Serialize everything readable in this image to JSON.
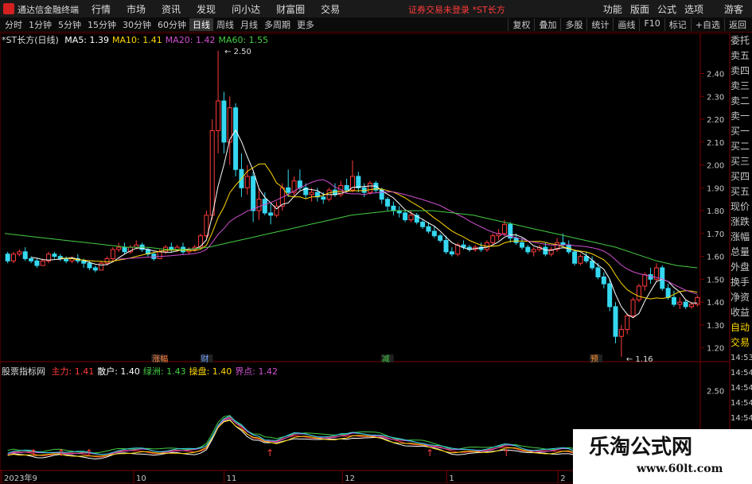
{
  "app": {
    "title": "通达信金融终端"
  },
  "menu": [
    "行情",
    "市场",
    "资讯",
    "发现",
    "问小达",
    "财富圈",
    "交易"
  ],
  "status_notice": "证券交易未登录  *ST长方",
  "right_menu": [
    "功能",
    "版面",
    "公式",
    "选项"
  ],
  "guest_label": "游客",
  "periods": [
    "分时",
    "1分钟",
    "5分钟",
    "15分钟",
    "30分钟",
    "60分钟",
    "日线",
    "周线",
    "月线",
    "多周期",
    "更多"
  ],
  "active_period": "日线",
  "tools": [
    "复权",
    "叠加",
    "多股",
    "统计",
    "画线",
    "F10",
    "标记",
    "+自选",
    "返回"
  ],
  "stock_label": "*ST长方(日线)",
  "ma": [
    {
      "label": "MA5: 1.39",
      "color": "#ffffff"
    },
    {
      "label": "MA10: 1.41",
      "color": "#ffd700"
    },
    {
      "label": "MA20: 1.42",
      "color": "#d04fd0"
    },
    {
      "label": "MA60: 1.55",
      "color": "#44cc44"
    }
  ],
  "sidebar": [
    "委托",
    "卖五",
    "卖四",
    "卖三",
    "卖二",
    "卖一",
    "买一",
    "买二",
    "买三",
    "买四",
    "买五",
    "现价",
    "涨跌",
    "涨幅",
    "总量",
    "外盘",
    "换手",
    "净资",
    "收益",
    "自动",
    "交易",
    "14:53",
    "14:54",
    "14:54",
    "14:54",
    "14:54",
    "14:54",
    "14:54",
    "14:54"
  ],
  "sidebar_colors": {
    "auto": "#ffd700",
    "trade": "#ffd700"
  },
  "indicator": {
    "name": "股票指标网",
    "items": [
      {
        "label": "主力: 1.41",
        "color": "#ff3b3b"
      },
      {
        "label": "散户: 1.40",
        "color": "#ffffff"
      },
      {
        "label": "绿洲: 1.43",
        "color": "#44cc44"
      },
      {
        "label": "操盘: 1.40",
        "color": "#ffd700"
      },
      {
        "label": "界点: 1.42",
        "color": "#d04fd0"
      }
    ]
  },
  "markers": [
    {
      "text": "涨幅",
      "color": "#ff8040"
    },
    {
      "text": "财",
      "color": "#6fa0ff"
    },
    {
      "text": "减",
      "color": "#44cc44"
    },
    {
      "text": "预",
      "color": "#ff9030"
    }
  ],
  "annotations": {
    "high": "2.50",
    "low": "1.16"
  },
  "x_dates": [
    "2023年9",
    "10",
    "11",
    "12",
    "1",
    "2"
  ],
  "colors": {
    "up": "#ff3b3b",
    "down": "#35d8f0",
    "axis": "#7a0000",
    "grid": "#400000"
  },
  "chart_data": {
    "type": "candlestick",
    "title": "*ST长方(日线)",
    "y_ticks": [
      1.2,
      1.3,
      1.4,
      1.5,
      1.6,
      1.7,
      1.8,
      1.9,
      2.0,
      2.1,
      2.2,
      2.3,
      2.4
    ],
    "ylim": [
      1.15,
      2.52
    ],
    "ind_ticks": [
      2.0,
      2.5
    ],
    "ind_ylim": [
      1.75,
      2.65
    ],
    "ohlc": [
      [
        1.61,
        1.62,
        1.57,
        1.58
      ],
      [
        1.58,
        1.62,
        1.57,
        1.61
      ],
      [
        1.61,
        1.63,
        1.6,
        1.62
      ],
      [
        1.62,
        1.64,
        1.58,
        1.59
      ],
      [
        1.59,
        1.6,
        1.57,
        1.58
      ],
      [
        1.58,
        1.59,
        1.55,
        1.56
      ],
      [
        1.56,
        1.59,
        1.56,
        1.58
      ],
      [
        1.58,
        1.62,
        1.57,
        1.61
      ],
      [
        1.61,
        1.62,
        1.59,
        1.6
      ],
      [
        1.6,
        1.61,
        1.58,
        1.59
      ],
      [
        1.59,
        1.6,
        1.57,
        1.58
      ],
      [
        1.58,
        1.6,
        1.57,
        1.59
      ],
      [
        1.59,
        1.61,
        1.57,
        1.58
      ],
      [
        1.58,
        1.59,
        1.55,
        1.57
      ],
      [
        1.57,
        1.58,
        1.54,
        1.55
      ],
      [
        1.55,
        1.56,
        1.53,
        1.54
      ],
      [
        1.54,
        1.58,
        1.54,
        1.57
      ],
      [
        1.57,
        1.6,
        1.56,
        1.59
      ],
      [
        1.59,
        1.64,
        1.58,
        1.63
      ],
      [
        1.63,
        1.66,
        1.62,
        1.64
      ],
      [
        1.64,
        1.66,
        1.61,
        1.62
      ],
      [
        1.62,
        1.65,
        1.61,
        1.64
      ],
      [
        1.64,
        1.67,
        1.63,
        1.65
      ],
      [
        1.65,
        1.66,
        1.62,
        1.63
      ],
      [
        1.63,
        1.64,
        1.6,
        1.61
      ],
      [
        1.61,
        1.62,
        1.58,
        1.59
      ],
      [
        1.59,
        1.63,
        1.59,
        1.62
      ],
      [
        1.62,
        1.65,
        1.61,
        1.64
      ],
      [
        1.64,
        1.66,
        1.62,
        1.63
      ],
      [
        1.63,
        1.65,
        1.62,
        1.64
      ],
      [
        1.64,
        1.66,
        1.61,
        1.62
      ],
      [
        1.62,
        1.64,
        1.61,
        1.63
      ],
      [
        1.63,
        1.65,
        1.62,
        1.64
      ],
      [
        1.64,
        1.7,
        1.63,
        1.69
      ],
      [
        1.69,
        1.8,
        1.68,
        1.78
      ],
      [
        1.78,
        2.2,
        1.76,
        2.15
      ],
      [
        2.15,
        2.5,
        2.05,
        2.28
      ],
      [
        2.28,
        2.32,
        2.05,
        2.1
      ],
      [
        2.1,
        2.3,
        2.0,
        2.25
      ],
      [
        2.25,
        2.27,
        1.95,
        1.98
      ],
      [
        1.98,
        2.05,
        1.86,
        1.9
      ],
      [
        1.9,
        2.0,
        1.87,
        1.95
      ],
      [
        1.95,
        1.97,
        1.75,
        1.8
      ],
      [
        1.8,
        1.9,
        1.76,
        1.85
      ],
      [
        1.85,
        1.88,
        1.78,
        1.79
      ],
      [
        1.79,
        1.83,
        1.74,
        1.78
      ],
      [
        1.78,
        1.84,
        1.77,
        1.82
      ],
      [
        1.82,
        1.92,
        1.8,
        1.9
      ],
      [
        1.9,
        1.98,
        1.86,
        1.88
      ],
      [
        1.88,
        1.95,
        1.86,
        1.93
      ],
      [
        1.93,
        1.98,
        1.89,
        1.9
      ],
      [
        1.9,
        1.92,
        1.85,
        1.87
      ],
      [
        1.87,
        1.9,
        1.84,
        1.88
      ],
      [
        1.88,
        1.9,
        1.84,
        1.86
      ],
      [
        1.86,
        1.88,
        1.83,
        1.85
      ],
      [
        1.85,
        1.9,
        1.84,
        1.89
      ],
      [
        1.89,
        1.92,
        1.86,
        1.87
      ],
      [
        1.87,
        1.93,
        1.86,
        1.91
      ],
      [
        1.91,
        1.94,
        1.88,
        1.89
      ],
      [
        1.89,
        2.02,
        1.88,
        1.95
      ],
      [
        1.95,
        1.97,
        1.88,
        1.9
      ],
      [
        1.9,
        1.92,
        1.86,
        1.88
      ],
      [
        1.88,
        1.93,
        1.87,
        1.92
      ],
      [
        1.92,
        1.93,
        1.88,
        1.89
      ],
      [
        1.89,
        1.9,
        1.83,
        1.85
      ],
      [
        1.85,
        1.86,
        1.8,
        1.82
      ],
      [
        1.82,
        1.84,
        1.78,
        1.8
      ],
      [
        1.8,
        1.82,
        1.77,
        1.79
      ],
      [
        1.79,
        1.8,
        1.75,
        1.76
      ],
      [
        1.76,
        1.8,
        1.75,
        1.78
      ],
      [
        1.78,
        1.79,
        1.74,
        1.75
      ],
      [
        1.75,
        1.76,
        1.72,
        1.73
      ],
      [
        1.73,
        1.75,
        1.7,
        1.71
      ],
      [
        1.71,
        1.73,
        1.68,
        1.69
      ],
      [
        1.69,
        1.7,
        1.66,
        1.67
      ],
      [
        1.67,
        1.69,
        1.61,
        1.62
      ],
      [
        1.62,
        1.64,
        1.6,
        1.61
      ],
      [
        1.61,
        1.66,
        1.6,
        1.65
      ],
      [
        1.65,
        1.67,
        1.63,
        1.64
      ],
      [
        1.64,
        1.65,
        1.62,
        1.63
      ],
      [
        1.63,
        1.65,
        1.62,
        1.64
      ],
      [
        1.64,
        1.66,
        1.62,
        1.63
      ],
      [
        1.63,
        1.67,
        1.62,
        1.66
      ],
      [
        1.66,
        1.7,
        1.65,
        1.69
      ],
      [
        1.69,
        1.72,
        1.67,
        1.7
      ],
      [
        1.7,
        1.76,
        1.69,
        1.74
      ],
      [
        1.74,
        1.75,
        1.66,
        1.68
      ],
      [
        1.68,
        1.7,
        1.65,
        1.66
      ],
      [
        1.66,
        1.68,
        1.63,
        1.64
      ],
      [
        1.64,
        1.65,
        1.61,
        1.62
      ],
      [
        1.62,
        1.64,
        1.6,
        1.63
      ],
      [
        1.63,
        1.65,
        1.62,
        1.64
      ],
      [
        1.64,
        1.66,
        1.6,
        1.61
      ],
      [
        1.61,
        1.64,
        1.6,
        1.63
      ],
      [
        1.63,
        1.68,
        1.62,
        1.66
      ],
      [
        1.66,
        1.7,
        1.64,
        1.65
      ],
      [
        1.65,
        1.67,
        1.61,
        1.62
      ],
      [
        1.62,
        1.63,
        1.56,
        1.57
      ],
      [
        1.57,
        1.61,
        1.56,
        1.6
      ],
      [
        1.6,
        1.62,
        1.57,
        1.58
      ],
      [
        1.58,
        1.6,
        1.54,
        1.55
      ],
      [
        1.55,
        1.57,
        1.5,
        1.51
      ],
      [
        1.51,
        1.53,
        1.46,
        1.48
      ],
      [
        1.48,
        1.5,
        1.36,
        1.38
      ],
      [
        1.38,
        1.4,
        1.22,
        1.25
      ],
      [
        1.25,
        1.3,
        1.16,
        1.28
      ],
      [
        1.28,
        1.35,
        1.26,
        1.34
      ],
      [
        1.34,
        1.42,
        1.33,
        1.41
      ],
      [
        1.41,
        1.48,
        1.4,
        1.47
      ],
      [
        1.47,
        1.53,
        1.45,
        1.52
      ],
      [
        1.52,
        1.55,
        1.48,
        1.5
      ],
      [
        1.5,
        1.57,
        1.49,
        1.55
      ],
      [
        1.55,
        1.56,
        1.45,
        1.46
      ],
      [
        1.46,
        1.48,
        1.41,
        1.42
      ],
      [
        1.42,
        1.45,
        1.38,
        1.39
      ],
      [
        1.39,
        1.42,
        1.37,
        1.4
      ],
      [
        1.4,
        1.41,
        1.37,
        1.38
      ],
      [
        1.38,
        1.4,
        1.37,
        1.39
      ],
      [
        1.39,
        1.43,
        1.38,
        1.42
      ]
    ],
    "ma60": [
      1.7,
      1.69,
      1.68,
      1.67,
      1.66,
      1.65,
      1.64,
      1.64,
      1.63,
      1.63,
      1.64,
      1.66,
      1.68,
      1.7,
      1.72,
      1.74,
      1.76,
      1.78,
      1.79,
      1.8,
      1.8,
      1.8,
      1.79,
      1.78,
      1.76,
      1.74,
      1.72,
      1.7,
      1.68,
      1.66,
      1.64,
      1.61,
      1.58,
      1.56,
      1.55
    ]
  }
}
